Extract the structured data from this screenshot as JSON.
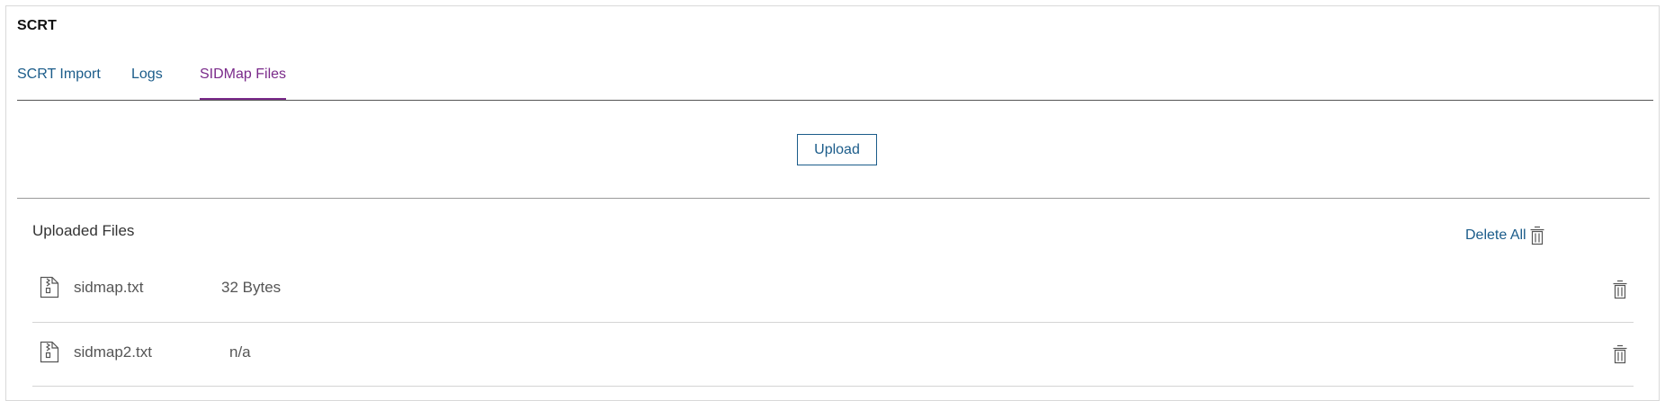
{
  "panel": {
    "title": "SCRT"
  },
  "tabs": [
    {
      "label": "SCRT Import",
      "active": false
    },
    {
      "label": "Logs",
      "active": false
    },
    {
      "label": "SIDMap Files",
      "active": true
    }
  ],
  "upload": {
    "button_label": "Upload"
  },
  "files": {
    "title": "Uploaded Files",
    "delete_all_label": "Delete All",
    "rows": [
      {
        "name": "sidmap.txt",
        "size": "32 Bytes"
      },
      {
        "name": "sidmap2.txt",
        "size": "n/a"
      }
    ]
  },
  "icons": {
    "file": "zip-file-icon",
    "delete": "trash-icon"
  },
  "colors": {
    "link": "#1b5c8a",
    "active_tab": "#7a2a8a",
    "text": "#555555"
  }
}
